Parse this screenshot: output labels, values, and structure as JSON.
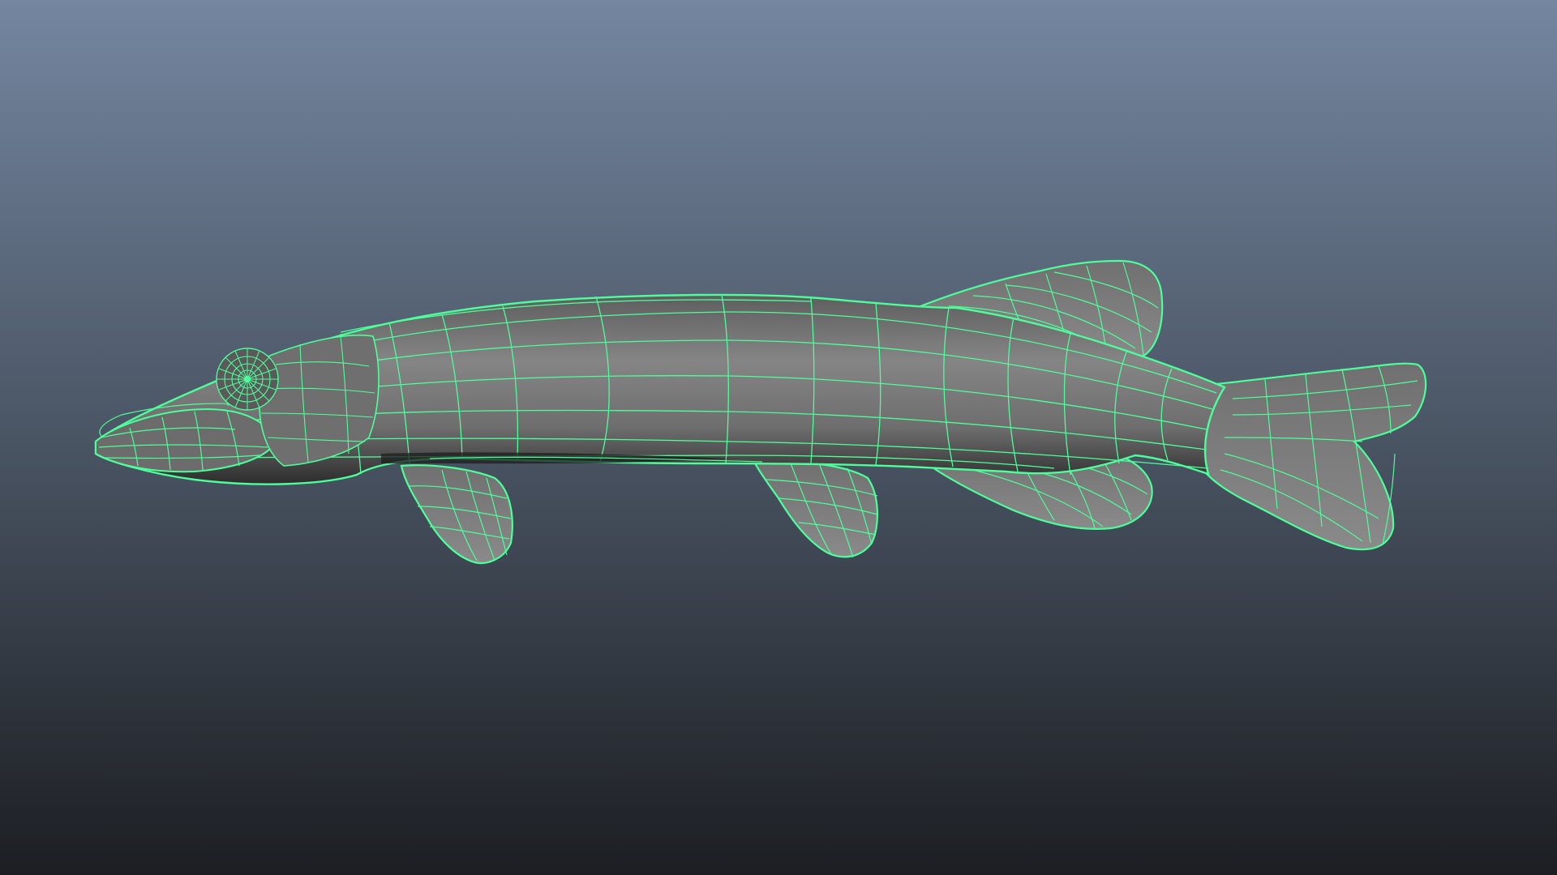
{
  "viewport": {
    "background_top": "#7486a0",
    "background_mid": "#4a5564",
    "background_bottom": "#1c1e22"
  },
  "model": {
    "mesh_fill": "#7a7a7a",
    "mesh_shadow": "#2a2a2a",
    "wireframe_color": "#4dff9a",
    "display_mode": "wireframe-on-shaded",
    "selected": true
  }
}
